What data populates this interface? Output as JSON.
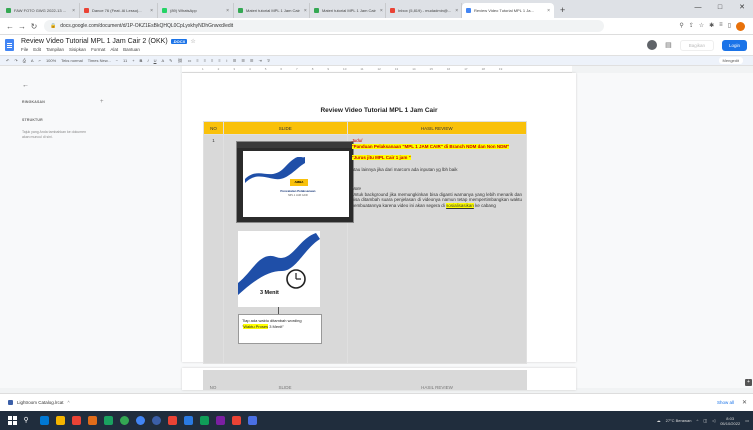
{
  "browser": {
    "tabs": [
      {
        "label": "FAW FOTO GWG 2022-13 ...",
        "color": "#34a853"
      },
      {
        "label": "Dance 76 (Feat. Al Lesso)...",
        "color": "#ea4335"
      },
      {
        "label": "(89) WhatsApp",
        "color": "#25d366"
      },
      {
        "label": "Materi tutorial MPL 1 Jam Cair",
        "color": "#34a853"
      },
      {
        "label": "Materi tutorial MPL 1 Jam Cair",
        "color": "#34a853"
      },
      {
        "label": "Inbox (5,819) - mudadmin@...",
        "color": "#ea4335"
      },
      {
        "label": "Review Video Tutorial MPL 1 Ja...",
        "color": "#4285f4",
        "active": true
      }
    ],
    "new_tab": "+",
    "url": "docs.google.com/document/d/1P-OKZ1EsBkQHQL0CpLyxkhyNDhGnwxd/edit"
  },
  "doc": {
    "title": "Review Video Tutorial MPL 1 Jam Cair 2 (OKK)",
    "badge": ".DOCX",
    "menus": [
      "File",
      "Edit",
      "Tampilan",
      "Sisipkan",
      "Format",
      "Alat",
      "Bantuan"
    ],
    "share_label": "Bagikan",
    "login_label": "Login",
    "toolbar": {
      "zoom": "100%",
      "style": "Teks normal",
      "font": "Times New...",
      "size": "11",
      "mode": "Mengedit"
    },
    "ruler": [
      "1",
      "2",
      "3",
      "4",
      "5",
      "6",
      "7",
      "8",
      "9",
      "10",
      "11",
      "12",
      "13",
      "14",
      "15",
      "16",
      "17",
      "18",
      "19"
    ]
  },
  "sidepanel": {
    "back": "←",
    "ringkasan": "RINGKASAN",
    "struktur": "STRUKTUR",
    "hint": "Tajuk yang Anda tambahkan ke dokumen akan muncul di sini."
  },
  "page": {
    "heading": "Review Video Tutorial MPL 1 Jam Cair",
    "table": {
      "headers": [
        "NO",
        "SLIDE",
        "HASIL REVIEW"
      ],
      "row_no": "1",
      "screenshot_title": "Pencatatan Pelaksanaan",
      "screenshot_sub": "MPL 1 JAM CAIR",
      "menit_label": "3 Menit",
      "note_line1": "Tiap ada waktu ditambah wording",
      "note_line2": "Waktu Proses",
      "note_line2_rest": " 3 Menit\"",
      "judul_label": "Judul",
      "judul_text": "\"Panduan Pelaksanaan \"MPL 1 JAM CAIR\" di Branch NDM dan Non NDM\"",
      "jurus": "\"Jurus jitu MPL Cair 1 jam \"",
      "atau": "atau lainnya jika dari marcom ada inputan yg lbh baik",
      "note_label": "Note",
      "note_text": "Untuk background jika memungkinkan bisa diganti warnanya yang lebih menarik dan bisa ditambah suara penjelasan di videonya namun tetap mempertimbangkan waktu pembuatannya karena video ini akan segera di",
      "note_link": "sosialisasikan",
      "note_tail": " ke cabang"
    }
  },
  "page2": {
    "headers": [
      "NO",
      "SLIDE",
      "HASIL REVIEW"
    ]
  },
  "download": {
    "file": "Lightroom Catalog.lrcat",
    "show_all": "Show all"
  },
  "taskbar": {
    "apps": [
      "#ffffff",
      "#0078d4",
      "#f4b400",
      "#ea4335",
      "#e06c1a",
      "#1aa260",
      "#34a853",
      "#4285f4",
      "#3b5fa8",
      "#ea4335",
      "#2a7ae2",
      "#0f9d58",
      "#7b1fa2",
      "#ea4335",
      "#4a6fe3"
    ],
    "weather": "27°C Berawan",
    "time": "8:03",
    "date": "05/10/2022"
  }
}
